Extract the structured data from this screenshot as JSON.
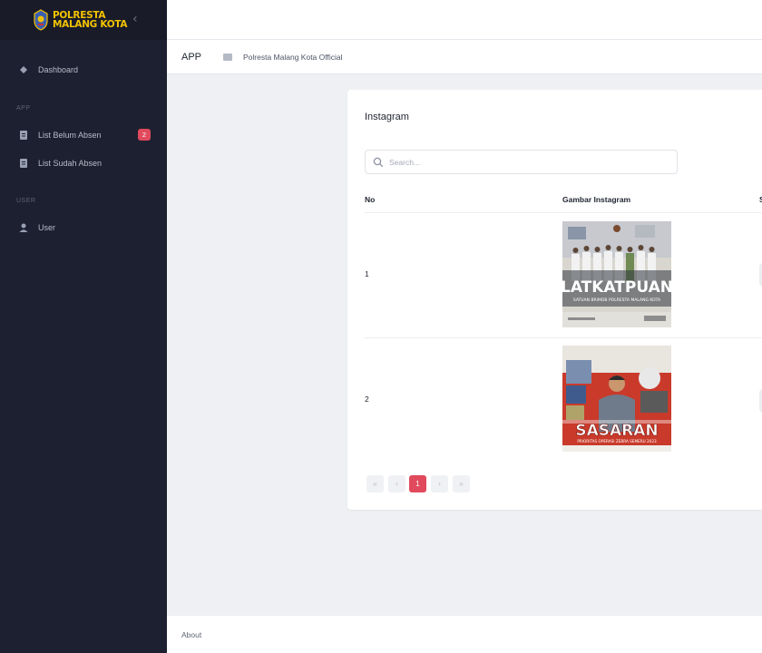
{
  "brand": {
    "line1": "POLRESTA",
    "line2": "MALANG KOTA"
  },
  "sidebar": {
    "items": [
      {
        "label": "Dashboard",
        "icon": "diamond-icon"
      },
      {
        "label": "List Belum Absen",
        "icon": "document-icon",
        "badge": "2"
      },
      {
        "label": "List Sudah Absen",
        "icon": "document-icon"
      },
      {
        "label": "User",
        "icon": "user-icon"
      }
    ],
    "sections": {
      "app": "APP",
      "user": "USER"
    }
  },
  "subbar": {
    "title": "APP",
    "breadcrumb": "Polresta Malang Kota Official"
  },
  "card": {
    "title": "Instagram",
    "search_placeholder": "Search...",
    "columns": [
      "No",
      "Gambar Instagram",
      "S"
    ],
    "rows": [
      {
        "no": "1",
        "image_text": "LATKATPUAN",
        "image_subtext": "SATUAN BRIMOB POLRESTA MALANG KOTA"
      },
      {
        "no": "2",
        "image_text": "SASARAN",
        "image_subtext": "PRIORITAS OPERASI ZEBRA SEMERU 2023"
      }
    ],
    "pagination": [
      "«",
      "‹",
      "1",
      "›",
      "»"
    ],
    "active_page": "1"
  },
  "footer": {
    "link": "About"
  },
  "colors": {
    "sidebar_bg": "#1d2030",
    "accent": "#e04a5c",
    "brand_gold": "#f2c200"
  }
}
